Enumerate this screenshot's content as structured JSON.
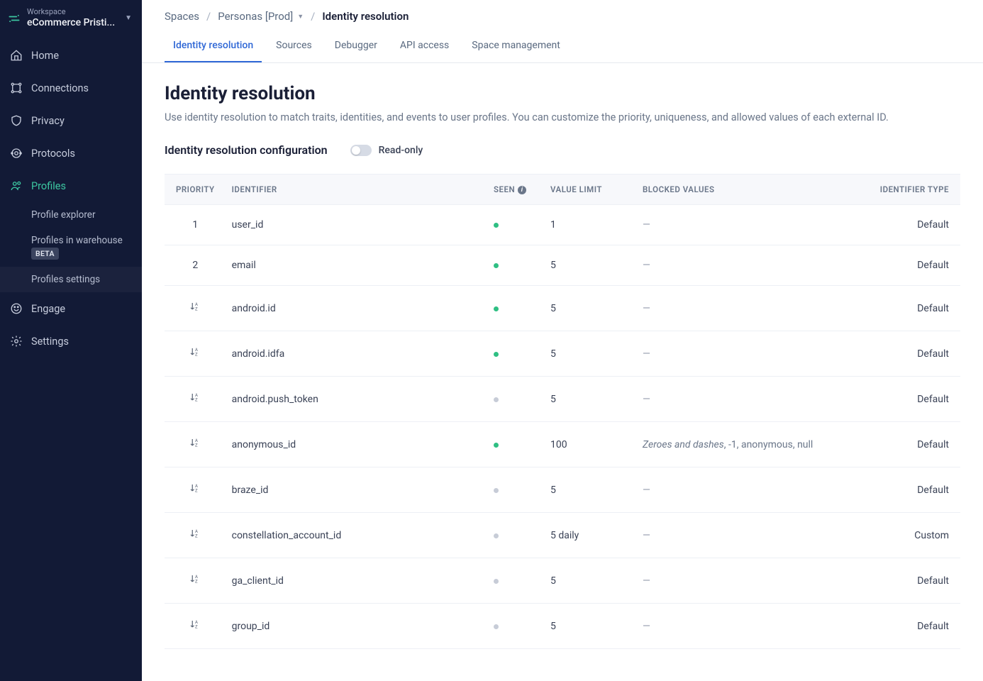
{
  "workspace": {
    "label": "Workspace",
    "name": "eCommerce Pristi..."
  },
  "sidebar": {
    "items": [
      {
        "label": "Home"
      },
      {
        "label": "Connections"
      },
      {
        "label": "Privacy"
      },
      {
        "label": "Protocols"
      },
      {
        "label": "Profiles"
      },
      {
        "label": "Engage"
      },
      {
        "label": "Settings"
      }
    ],
    "profiles_sub": [
      {
        "label": "Profile explorer"
      },
      {
        "label": "Profiles in warehouse",
        "badge": "BETA"
      },
      {
        "label": "Profiles settings"
      }
    ]
  },
  "breadcrumb": {
    "root": "Spaces",
    "space": "Personas [Prod]",
    "current": "Identity resolution"
  },
  "tabs": [
    "Identity resolution",
    "Sources",
    "Debugger",
    "API access",
    "Space management"
  ],
  "page": {
    "title": "Identity resolution",
    "description": "Use identity resolution to match traits, identities, and events to user profiles. You can customize the priority, uniqueness, and allowed values of each external ID.",
    "config_label": "Identity resolution configuration",
    "toggle_label": "Read-only"
  },
  "table": {
    "headers": {
      "priority": "PRIORITY",
      "identifier": "IDENTIFIER",
      "seen": "SEEN",
      "value_limit": "VALUE LIMIT",
      "blocked": "BLOCKED VALUES",
      "type": "IDENTIFIER TYPE"
    },
    "rows": [
      {
        "priority": "1",
        "sort": false,
        "identifier": "user_id",
        "seen": "green",
        "value_limit": "1",
        "blocked": "",
        "type": "Default"
      },
      {
        "priority": "2",
        "sort": false,
        "identifier": "email",
        "seen": "green",
        "value_limit": "5",
        "blocked": "",
        "type": "Default"
      },
      {
        "priority": "",
        "sort": true,
        "identifier": "android.id",
        "seen": "green",
        "value_limit": "5",
        "blocked": "",
        "type": "Default"
      },
      {
        "priority": "",
        "sort": true,
        "identifier": "android.idfa",
        "seen": "green",
        "value_limit": "5",
        "blocked": "",
        "type": "Default"
      },
      {
        "priority": "",
        "sort": true,
        "identifier": "android.push_token",
        "seen": "gray",
        "value_limit": "5",
        "blocked": "",
        "type": "Default"
      },
      {
        "priority": "",
        "sort": true,
        "identifier": "anonymous_id",
        "seen": "green",
        "value_limit": "100",
        "blocked_italic": "Zeroes and dashes",
        "blocked_rest": ", -1, anonymous, null",
        "type": "Default"
      },
      {
        "priority": "",
        "sort": true,
        "identifier": "braze_id",
        "seen": "gray",
        "value_limit": "5",
        "blocked": "",
        "type": "Default"
      },
      {
        "priority": "",
        "sort": true,
        "identifier": "constellation_account_id",
        "seen": "gray",
        "value_limit": "5 daily",
        "blocked": "",
        "type": "Custom"
      },
      {
        "priority": "",
        "sort": true,
        "identifier": "ga_client_id",
        "seen": "gray",
        "value_limit": "5",
        "blocked": "",
        "type": "Default"
      },
      {
        "priority": "",
        "sort": true,
        "identifier": "group_id",
        "seen": "gray",
        "value_limit": "5",
        "blocked": "",
        "type": "Default"
      }
    ]
  }
}
